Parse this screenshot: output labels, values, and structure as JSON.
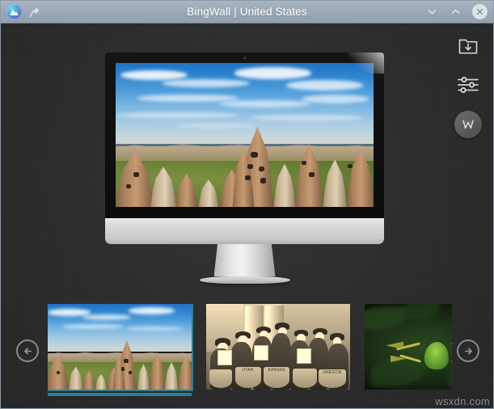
{
  "window": {
    "title": "BingWall | United States",
    "app_name": "BingWall",
    "region": "United States"
  },
  "titlebar": {
    "app_icon": "bingwall-app-icon",
    "pin_label": "pin-icon",
    "minimize_label": "chevron-down-icon",
    "maximize_label": "chevron-up-icon",
    "close_label": "close-icon",
    "background_color": "#9aa7b5",
    "text_color": "#ffffff"
  },
  "toolbar": {
    "download_label": "folder-download-icon",
    "settings_label": "sliders-icon",
    "set_wallpaper_label": "W"
  },
  "preview": {
    "device": "desktop-monitor",
    "image_title": "Cappadocia rock formations",
    "image_alt": "Fairy chimney rock formations under a blue cloudy sky, Cappadocia"
  },
  "carousel": {
    "prev_label": "arrow-left-icon",
    "next_label": "arrow-right-icon",
    "selected_index": 0,
    "accent_color": "#2e7f93",
    "thumbnails": [
      {
        "id": "thumb-cappadocia",
        "alt": "Cappadocia fairy chimneys landscape",
        "selected": true
      },
      {
        "id": "thumb-suffragettes",
        "alt": "Historic sepia photograph of suffragists with state banners",
        "selected": false,
        "banners": [
          "UTAH",
          "OREGON",
          "KANSAS"
        ]
      },
      {
        "id": "thumb-flying-frog",
        "alt": "Green flying frog gliding against dark foliage",
        "selected": false
      }
    ]
  },
  "footer": {
    "watermark": "wsxdn.com"
  },
  "theme": {
    "background": "#2b2b2b",
    "titlebar": "#9aa7b5",
    "accent": "#2e7f93"
  }
}
